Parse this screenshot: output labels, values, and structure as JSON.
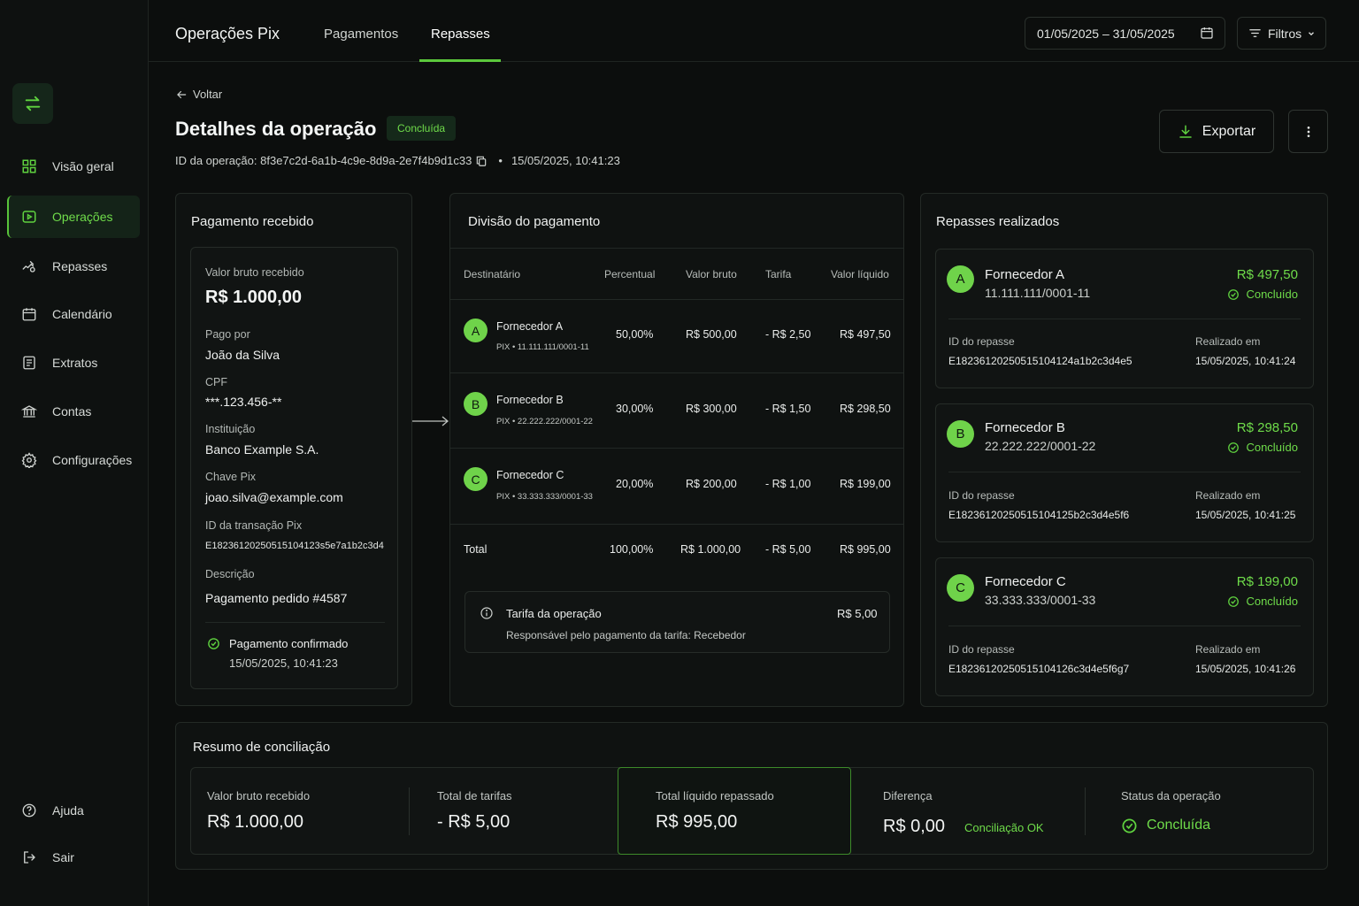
{
  "sidebar": {
    "items": [
      {
        "label": "Visão geral",
        "icon": "grid-icon"
      },
      {
        "label": "Operações",
        "icon": "operations-icon",
        "active": true
      },
      {
        "label": "Repasses",
        "icon": "transfer-hand-icon"
      },
      {
        "label": "Calendário",
        "icon": "calendar-icon"
      },
      {
        "label": "Extratos",
        "icon": "statement-icon"
      },
      {
        "label": "Contas",
        "icon": "bank-icon"
      },
      {
        "label": "Configurações",
        "icon": "gear-icon"
      }
    ],
    "help_label": "Ajuda",
    "logout_label": "Sair"
  },
  "header": {
    "title": "Operações Pix",
    "tabs": [
      {
        "label": "Pagamentos",
        "active": false
      },
      {
        "label": "Repasses",
        "active": true
      }
    ],
    "date_range": "01/05/2025 – 31/05/2025",
    "filters_label": "Filtros"
  },
  "page": {
    "back_label": "Voltar",
    "title": "Detalhes da operação",
    "status_badge": "Concluída",
    "operation_id": "ID da operação: 8f3e7c2d-6a1b-4c9e-8d9a-2e7f4b9d1c33",
    "operation_datetime": "15/05/2025, 10:41:23",
    "export_label": "Exportar"
  },
  "payment": {
    "title": "Pagamento recebido",
    "gross_label": "Valor bruto recebido",
    "gross_value": "R$ 1.000,00",
    "payer_label": "Pago por",
    "payer_value": "João da Silva",
    "cpf_label": "CPF",
    "cpf_value": "***.123.456-**",
    "institution_label": "Instituição",
    "institution_value": "Banco Example S.A.",
    "pix_key_label": "Chave Pix",
    "pix_key_value": "joao.silva@example.com",
    "tx_id_label": "ID da transação Pix",
    "tx_id_value": "E18236120250515104123s5e7a1b2c3d4",
    "description_label": "Descrição",
    "description_value": "Pagamento pedido #4587",
    "confirmed_label": "Pagamento confirmado",
    "confirmed_datetime": "15/05/2025, 10:41:23"
  },
  "split": {
    "title": "Divisão do pagamento",
    "columns": [
      "Destinatário",
      "Percentual",
      "Valor bruto",
      "Tarifa",
      "Valor líquido"
    ],
    "rows": [
      {
        "initial": "A",
        "name": "Fornecedor A",
        "sub": "PIX • 11.111.111/0001-11",
        "percent": "50,00%",
        "gross": "R$ 500,00",
        "fee": "- R$ 2,50",
        "net": "R$ 497,50"
      },
      {
        "initial": "B",
        "name": "Fornecedor B",
        "sub": "PIX • 22.222.222/0001-22",
        "percent": "30,00%",
        "gross": "R$ 300,00",
        "fee": "- R$ 1,50",
        "net": "R$ 298,50"
      },
      {
        "initial": "C",
        "name": "Fornecedor C",
        "sub": "PIX • 33.333.333/0001-33",
        "percent": "20,00%",
        "gross": "R$ 200,00",
        "fee": "- R$ 1,00",
        "net": "R$ 199,00"
      }
    ],
    "total": {
      "label": "Total",
      "percent": "100,00%",
      "gross": "R$ 1.000,00",
      "fee": "- R$ 5,00",
      "net": "R$ 995,00"
    },
    "fee_box": {
      "title": "Tarifa da operação",
      "value": "R$ 5,00",
      "note": "Responsável pelo pagamento da tarifa: Recebedor"
    }
  },
  "transfers": {
    "title": "Repasses realizados",
    "id_label": "ID do repasse",
    "done_label": "Realizado em",
    "items": [
      {
        "initial": "A",
        "name": "Fornecedor A",
        "doc": "11.111.111/0001-11",
        "amount": "R$ 497,50",
        "status": "Concluído",
        "id": "E18236120250515104124a1b2c3d4e5",
        "datetime": "15/05/2025, 10:41:24"
      },
      {
        "initial": "B",
        "name": "Fornecedor B",
        "doc": "22.222.222/0001-22",
        "amount": "R$ 298,50",
        "status": "Concluído",
        "id": "E18236120250515104125b2c3d4e5f6",
        "datetime": "15/05/2025, 10:41:25"
      },
      {
        "initial": "C",
        "name": "Fornecedor C",
        "doc": "33.333.333/0001-33",
        "amount": "R$ 199,00",
        "status": "Concluído",
        "id": "E18236120250515104126c3d4e5f6g7",
        "datetime": "15/05/2025, 10:41:26"
      }
    ]
  },
  "summary": {
    "title": "Resumo de conciliação",
    "gross_label": "Valor bruto recebido",
    "gross_value": "R$ 1.000,00",
    "fees_label": "Total de tarifas",
    "fees_value": "- R$ 5,00",
    "net_label": "Total líquido repassado",
    "net_value": "R$ 995,00",
    "diff_label": "Diferença",
    "diff_value": "R$ 0,00",
    "diff_status": "Conciliação OK",
    "status_label": "Status da operação",
    "status_value": "Concluída"
  },
  "colors": {
    "accent": "#6fdc4a",
    "background": "#0c0e0d",
    "panel": "#0f1211"
  }
}
